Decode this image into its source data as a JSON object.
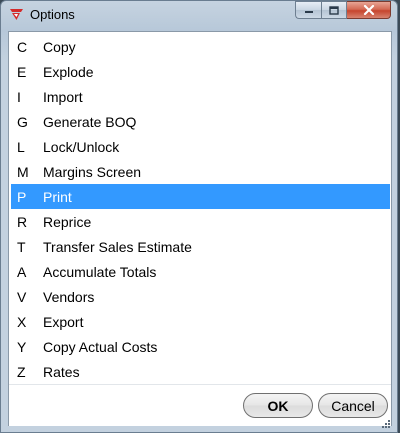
{
  "window": {
    "title": "Options",
    "colors": {
      "selection": "#3399ff",
      "selection_text": "#ffffff",
      "list_background": "#ffffff",
      "frame": "#c3d1df",
      "close_button": "#c6452e"
    },
    "icons": [
      "app-logo-icon",
      "minimize-icon",
      "maximize-icon",
      "close-icon",
      "resize-grip-icon"
    ]
  },
  "options": [
    {
      "key": "C",
      "label": "Copy"
    },
    {
      "key": "E",
      "label": "Explode"
    },
    {
      "key": "I",
      "label": "Import"
    },
    {
      "key": "G",
      "label": "Generate BOQ"
    },
    {
      "key": "L",
      "label": "Lock/Unlock"
    },
    {
      "key": "M",
      "label": "Margins Screen"
    },
    {
      "key": "P",
      "label": "Print"
    },
    {
      "key": "R",
      "label": "Reprice"
    },
    {
      "key": "T",
      "label": "Transfer Sales Estimate"
    },
    {
      "key": "A",
      "label": "Accumulate Totals"
    },
    {
      "key": "V",
      "label": "Vendors"
    },
    {
      "key": "X",
      "label": "Export"
    },
    {
      "key": "Y",
      "label": "Copy Actual Costs"
    },
    {
      "key": "Z",
      "label": "Rates"
    }
  ],
  "selected_option": "Print",
  "buttons": {
    "ok": "OK",
    "cancel": "Cancel"
  }
}
